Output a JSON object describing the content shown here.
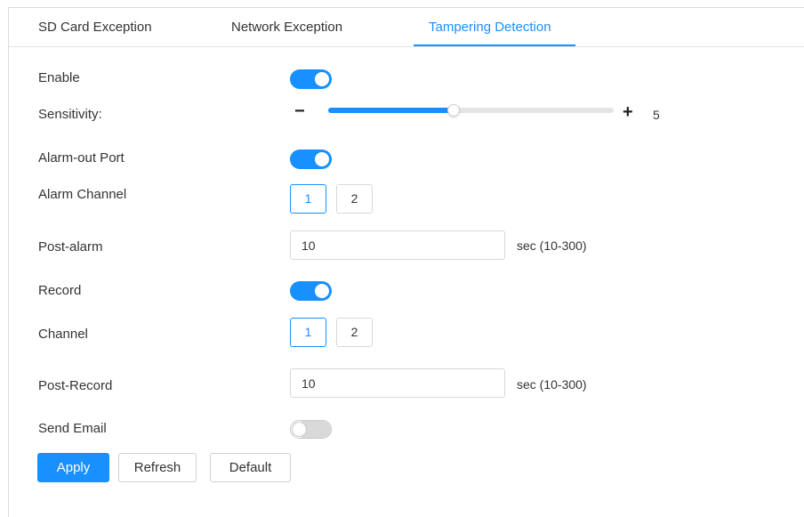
{
  "tabs": [
    {
      "label": "SD Card Exception",
      "active": false
    },
    {
      "label": "Network Exception",
      "active": false
    },
    {
      "label": "Tampering Detection",
      "active": true
    }
  ],
  "form": {
    "enable": {
      "label": "Enable",
      "on": true
    },
    "sensitivity": {
      "label": "Sensitivity:",
      "minus": "−",
      "plus": "+",
      "value": "5",
      "min": 1,
      "max": 10,
      "fraction": 0.44
    },
    "alarm_out_port": {
      "label": "Alarm-out Port",
      "on": true
    },
    "alarm_channel": {
      "label": "Alarm Channel",
      "options": [
        "1",
        "2"
      ],
      "selected": "1"
    },
    "post_alarm": {
      "label": "Post-alarm",
      "value": "10",
      "unit": "sec (10-300)"
    },
    "record": {
      "label": "Record",
      "on": true
    },
    "channel": {
      "label": "Channel",
      "options": [
        "1",
        "2"
      ],
      "selected": "1"
    },
    "post_record": {
      "label": "Post-Record",
      "value": "10",
      "unit": "sec (10-300)"
    },
    "send_email": {
      "label": "Send Email",
      "on": false
    }
  },
  "actions": {
    "apply": "Apply",
    "refresh": "Refresh",
    "default": "Default"
  },
  "colors": {
    "accent": "#1890ff",
    "border": "#d9d9d9",
    "text": "#333333"
  }
}
